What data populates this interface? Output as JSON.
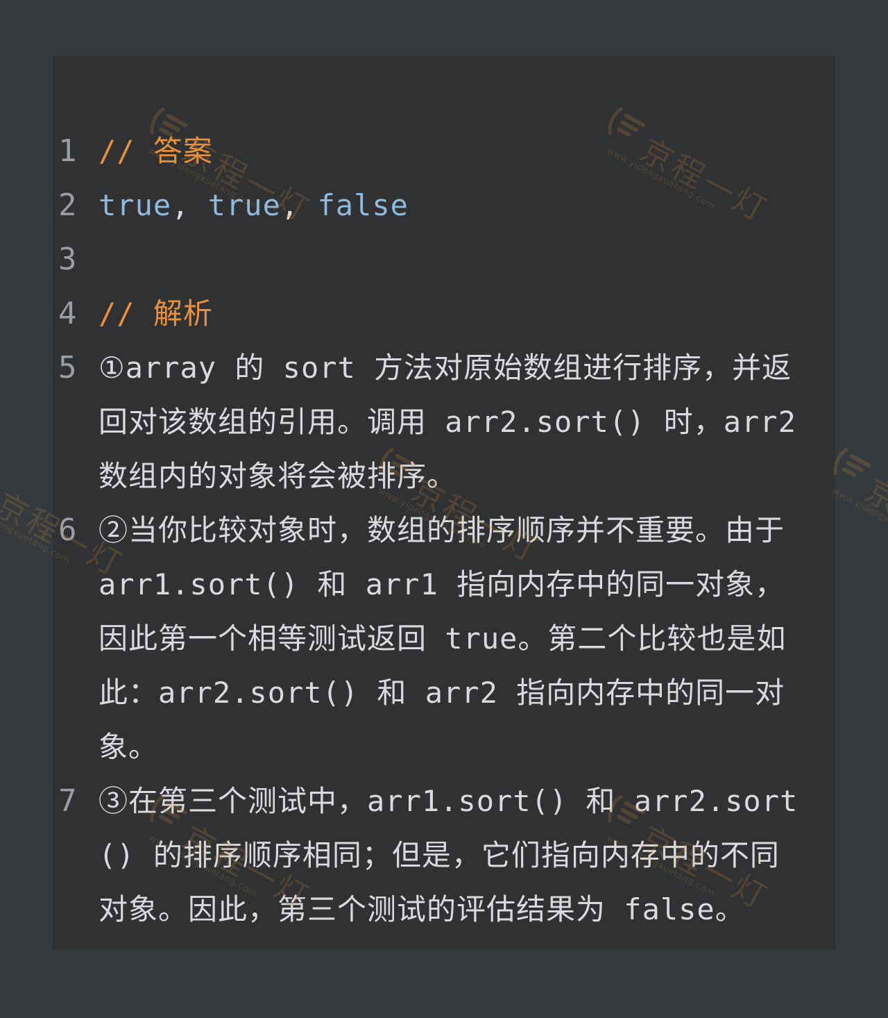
{
  "editor": {
    "lines": [
      {
        "number": "1",
        "tokens": [
          {
            "type": "comment",
            "text": "// 答案"
          }
        ]
      },
      {
        "number": "2",
        "tokens": [
          {
            "type": "keyword",
            "text": "true"
          },
          {
            "type": "punct",
            "text": ", "
          },
          {
            "type": "keyword",
            "text": "true"
          },
          {
            "type": "punct",
            "text": ", "
          },
          {
            "type": "keyword",
            "text": "false"
          }
        ]
      },
      {
        "number": "3",
        "tokens": []
      },
      {
        "number": "4",
        "tokens": [
          {
            "type": "comment",
            "text": "// 解析"
          }
        ]
      },
      {
        "number": "5",
        "tokens": [
          {
            "type": "plain",
            "text": "①array 的 sort 方法对原始数组进行排序，并返回对该数组的引用。调用 arr2.sort() 时，arr2 数组内的对象将会被排序。"
          }
        ]
      },
      {
        "number": "6",
        "tokens": [
          {
            "type": "plain",
            "text": "②当你比较对象时，数组的排序顺序并不重要。由于 arr1.sort() 和 arr1 指向内存中的同一对象，因此第一个相等测试返回 true。第二个比较也是如此：arr2.sort() 和 arr2 指向内存中的同一对象。"
          }
        ]
      },
      {
        "number": "7",
        "tokens": [
          {
            "type": "plain",
            "text": "③在第三个测试中，arr1.sort() 和 arr2.sort() 的排序顺序相同；但是，它们指向内存中的不同对象。因此，第三个测试的评估结果为 false。"
          }
        ]
      }
    ]
  },
  "watermark": {
    "name": "京程一灯",
    "url": "www.yidengxuetang.com",
    "color": "#c88a3a"
  },
  "colors": {
    "background": "#353a3f",
    "panel": "#2f3133",
    "comment": "#e8913a",
    "keyword": "#8fbadc",
    "text": "#d8dadd",
    "line_number": "#9a9da2"
  }
}
